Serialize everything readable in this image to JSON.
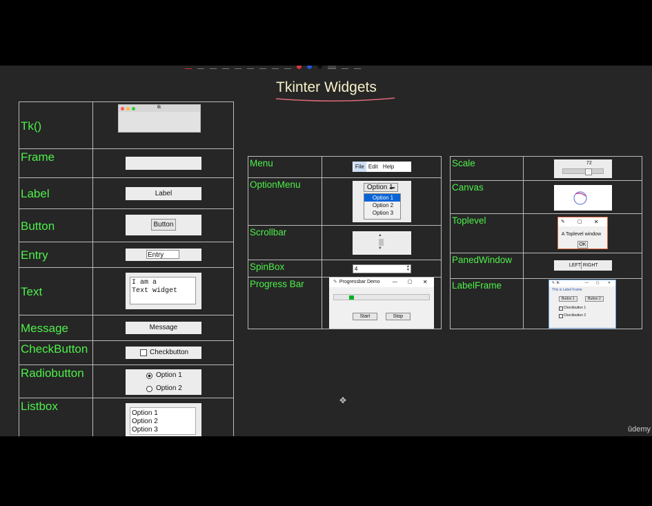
{
  "title": "Tkinter Widgets",
  "left_table": {
    "rows": [
      {
        "label": "Tk()"
      },
      {
        "label": "Frame"
      },
      {
        "label": "Label"
      },
      {
        "label": "Button"
      },
      {
        "label": "Entry"
      },
      {
        "label": "Text"
      },
      {
        "label": "Message"
      },
      {
        "label": "CheckButton"
      },
      {
        "label": "Radiobutton"
      },
      {
        "label": "Listbox"
      }
    ]
  },
  "middle_table": {
    "rows": [
      {
        "label": "Menu"
      },
      {
        "label": "OptionMenu"
      },
      {
        "label": "Scrollbar"
      },
      {
        "label": "SpinBox"
      },
      {
        "label": "Progress Bar"
      }
    ]
  },
  "right_table": {
    "rows": [
      {
        "label": "Scale"
      },
      {
        "label": "Canvas"
      },
      {
        "label": "Toplevel"
      },
      {
        "label": "PanedWindow"
      },
      {
        "label": "LabelFrame"
      }
    ]
  },
  "widgets": {
    "tk_title": "tk",
    "label_text": "Label",
    "button_text": "Button",
    "entry_value": "Entry",
    "text_line1": "I am a",
    "text_line2": "Text widget",
    "message_text": "Message",
    "checkbutton_text": "Checkbutton",
    "radio_option1": "Option 1",
    "radio_option2": "Option 2",
    "listbox_items": [
      "Option 1",
      "Option 2",
      "Option 3"
    ],
    "menu_items": [
      "File",
      "Edit",
      "Help"
    ],
    "optionmenu_selected": "Option 1",
    "optionmenu_items": [
      "Option 1",
      "Option 2",
      "Option 3"
    ],
    "spinbox_value": "4",
    "progress_title": "Progressbar Demo",
    "progress_level": 0.05,
    "progress_start": "Start",
    "progress_stop": "Stop",
    "scale_value": "72",
    "toplevel_text": "A Toplevel window",
    "toplevel_ok": "OK",
    "paned_left": "LEFT",
    "paned_right": "RIGHT",
    "labelframe_title": "tk",
    "labelframe_label": "This is Label Frame",
    "labelframe_button1": "Button 1",
    "labelframe_button2": "Button 2",
    "labelframe_check1": "Checkbutton 1",
    "labelframe_check2": "Checkbutton 2"
  },
  "watermark": "ûdemy",
  "colors": {
    "label_green": "#4ef04a",
    "title": "#f7f0c8",
    "background": "#262626"
  }
}
